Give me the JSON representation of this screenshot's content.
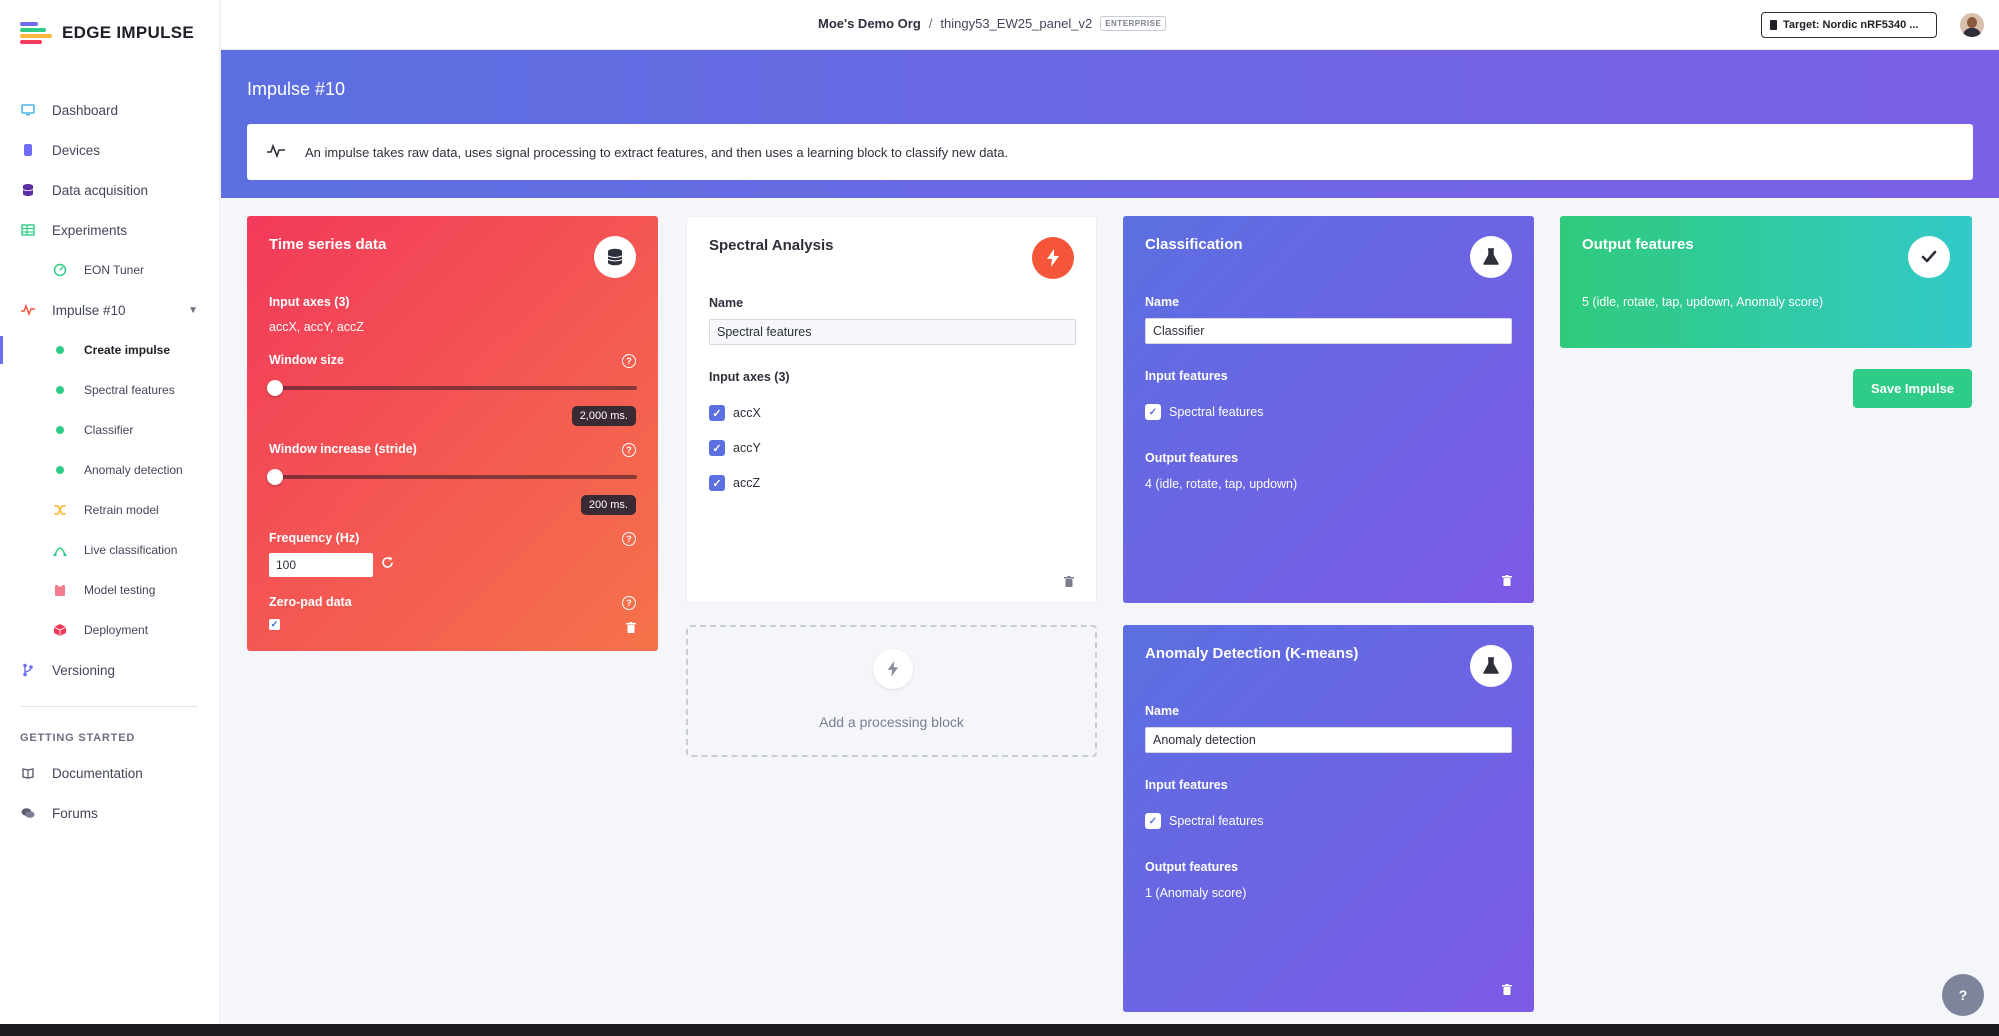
{
  "app": {
    "name": "EDGE IMPULSE"
  },
  "sidebar": {
    "items": [
      {
        "label": "Dashboard",
        "icon": "monitor-icon",
        "color": "#4fb3e8"
      },
      {
        "label": "Devices",
        "icon": "device-icon",
        "color": "#6e6cf5"
      },
      {
        "label": "Data acquisition",
        "icon": "database-icon",
        "color": "#5a2ea0"
      },
      {
        "label": "Experiments",
        "icon": "table-icon",
        "color": "#2ecc86"
      },
      {
        "label": "EON Tuner",
        "icon": "tuner-icon",
        "color": "#2ecc86"
      },
      {
        "label": "Impulse #10",
        "icon": "pulse-icon",
        "color": "#f5563a"
      },
      {
        "label": "Create impulse"
      },
      {
        "label": "Spectral features"
      },
      {
        "label": "Classifier"
      },
      {
        "label": "Anomaly detection"
      },
      {
        "label": "Retrain model",
        "icon": "shuffle-icon",
        "color": "#f5b83a"
      },
      {
        "label": "Live classification",
        "icon": "live-icon",
        "color": "#2ecc86"
      },
      {
        "label": "Model testing",
        "icon": "clipboard-icon",
        "color": "#f27b8e"
      },
      {
        "label": "Deployment",
        "icon": "package-icon",
        "color": "#f23a5b"
      },
      {
        "label": "Versioning",
        "icon": "branch-icon",
        "color": "#6e6cf5"
      }
    ],
    "section_label": "GETTING STARTED",
    "links": [
      {
        "label": "Documentation",
        "icon": "book-icon"
      },
      {
        "label": "Forums",
        "icon": "chat-icon"
      }
    ]
  },
  "topbar": {
    "org": "Moe's Demo Org",
    "separator": "/",
    "project": "thingy53_EW25_panel_v2",
    "badge": "ENTERPRISE",
    "target": "Target: Nordic nRF5340 ..."
  },
  "page": {
    "title": "Impulse #10",
    "info": "An impulse takes raw data, uses signal processing to extract features, and then uses a learning block to classify new data."
  },
  "timeseries": {
    "title": "Time series data",
    "input_axes_label": "Input axes (3)",
    "input_axes_value": "accX, accY, accZ",
    "window_size_label": "Window size",
    "window_size_value": "2,000 ms.",
    "window_size_fraction": 0.0,
    "window_increase_label": "Window increase (stride)",
    "window_increase_value": "200 ms.",
    "window_increase_fraction": 0.0,
    "frequency_label": "Frequency (Hz)",
    "frequency_value": "100",
    "zeropad_label": "Zero-pad data",
    "zeropad_checked": true
  },
  "spectral": {
    "title": "Spectral Analysis",
    "name_label": "Name",
    "name_value": "Spectral features",
    "axes_label": "Input axes (3)",
    "axes": [
      "accX",
      "accY",
      "accZ"
    ]
  },
  "add_block": {
    "label": "Add a processing block"
  },
  "classification": {
    "title": "Classification",
    "name_label": "Name",
    "name_value": "Classifier",
    "input_label": "Input features",
    "input_item": "Spectral features",
    "output_label": "Output features",
    "output_value": "4 (idle, rotate, tap, updown)"
  },
  "anomaly": {
    "title": "Anomaly Detection (K-means)",
    "name_label": "Name",
    "name_value": "Anomaly detection",
    "input_label": "Input features",
    "input_item": "Spectral features",
    "output_label": "Output features",
    "output_value": "1 (Anomaly score)"
  },
  "output": {
    "title": "Output features",
    "value": "5 (idle, rotate, tap, updown, Anomaly score)"
  },
  "save_button": "Save Impulse",
  "colors": {
    "accent": "#6e6cf5",
    "green": "#2ecc86",
    "red": "#f23a5b",
    "orange": "#f5563a"
  }
}
